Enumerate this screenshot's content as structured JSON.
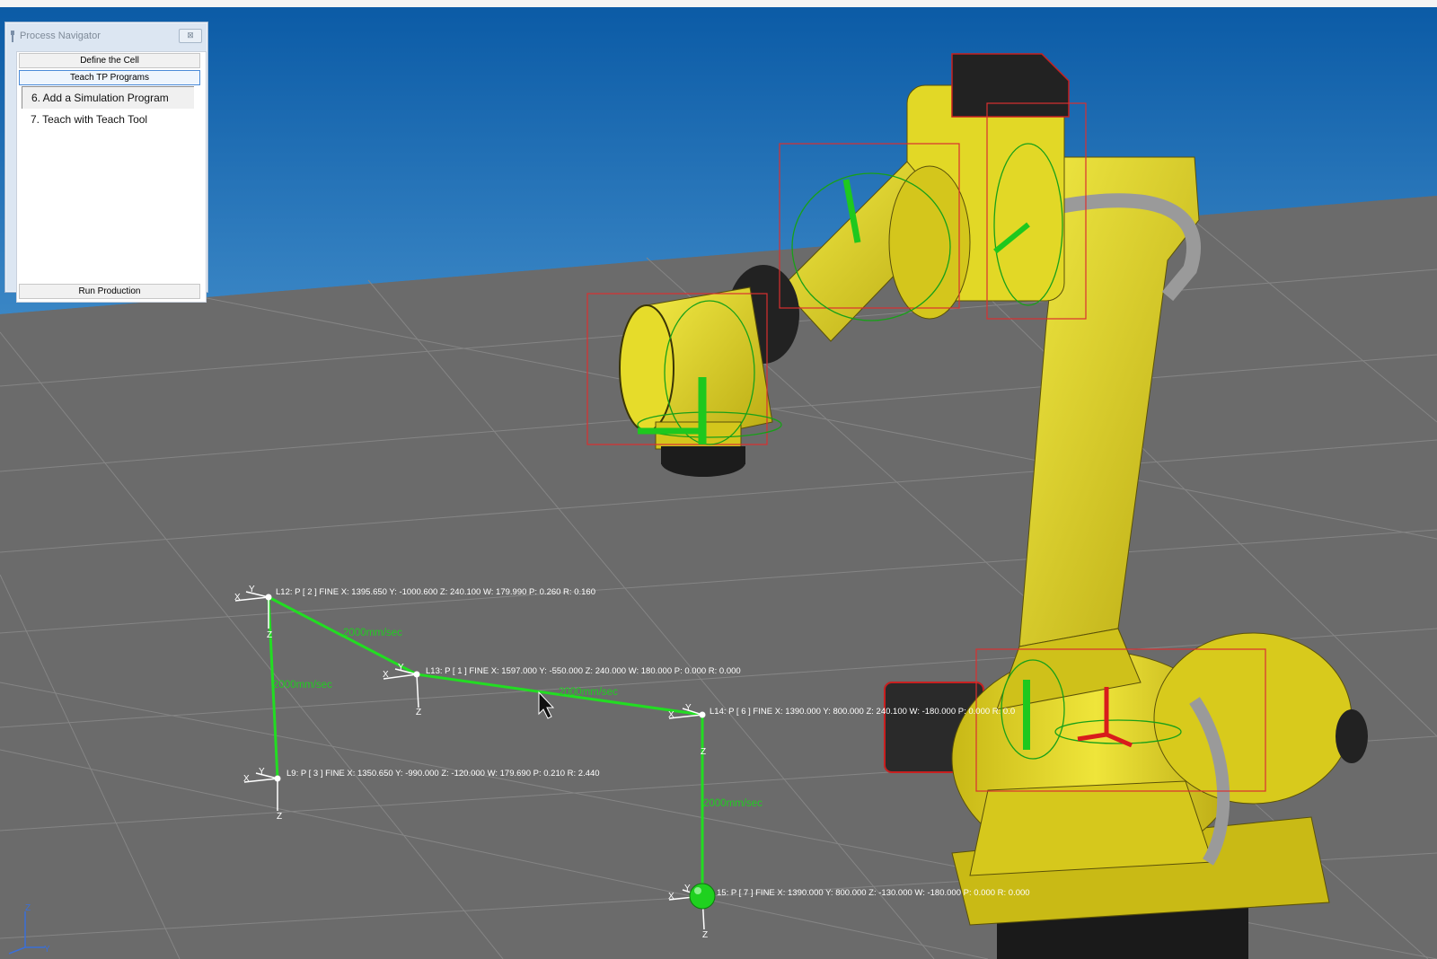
{
  "process_navigator": {
    "title": "Process Navigator",
    "close_glyph": "⊠",
    "sections": {
      "define_cell": "Define the Cell",
      "teach_tp": "Teach TP Programs",
      "run_production": "Run Production"
    },
    "steps": [
      {
        "label": "6.  Add a Simulation Program",
        "selected": true
      },
      {
        "label": "7.  Teach with Teach Tool",
        "selected": false
      }
    ]
  },
  "path": {
    "points": {
      "p1": {
        "label": "L12: P [ 2 ] FINE  X: 1395.650 Y: -1000.600 Z: 240.100 W: 179.990 P: 0.260 R: 0.160"
      },
      "p2": {
        "label": "L13: P [ 1 ] FINE  X: 1597.000 Y: -550.000 Z: 240.000 W: 180.000 P: 0.000 R: 0.000"
      },
      "p3": {
        "label": "L14: P [ 6 ]  FINE  X: 1390.000 Y:  800.000 Z:  240.100 W:  -180.000 P:  0.000  R:  0.0"
      },
      "p4": {
        "label": "L9: P [ 3 ]  FINE  X:  1350.650 Y:  -990.000 Z:  -120.000 W:  179.690  P:  0.210  R:  2.440"
      },
      "p5": {
        "label": "15: P [ 7 ]  FINE  X:  1390.000 Y:  800.000 Z:  -130.000 W:  -180.000  P:  0.000  R:  0.000"
      }
    },
    "speeds": {
      "s1": "2000mm/sec",
      "s2": "2000mm/sec",
      "s3": "2000mm/sec",
      "s4": "2000mm/sec"
    },
    "axis_labels": {
      "x": "X",
      "y": "Y",
      "z": "Z"
    }
  },
  "colors": {
    "sky_top": "#0b5ba6",
    "sky_bottom": "#2f80c2",
    "floor": "#6b6b6b",
    "robot_yellow": "#e8e12a",
    "robot_shadow": "#b3a514",
    "path_green": "#22dd22",
    "joint_box_red": "#d93030"
  }
}
